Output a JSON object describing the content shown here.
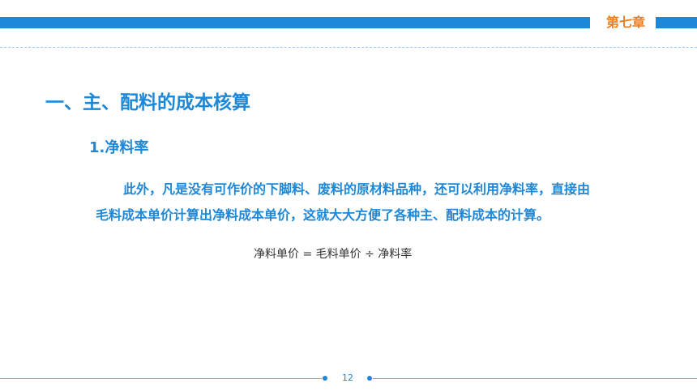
{
  "header": {
    "chapter": "第七章"
  },
  "content": {
    "section_title": "一、主、配料的成本核算",
    "sub_title": "1.净料率",
    "paragraph_line1": "此外，凡是没有可作价的下脚料、废料的原材料品种，还可以利用净料率，直接由",
    "paragraph_line2": "毛料成本单价计算出净料成本单价，这就大大方便了各种主、配料成本的计算。",
    "formula": "净料单价 = 毛料单价 ÷ 净料率"
  },
  "footer": {
    "page_number": "12"
  },
  "colors": {
    "primary_blue": "#1e88d8",
    "accent_orange": "#f07d1b",
    "formula_text": "#333333"
  }
}
